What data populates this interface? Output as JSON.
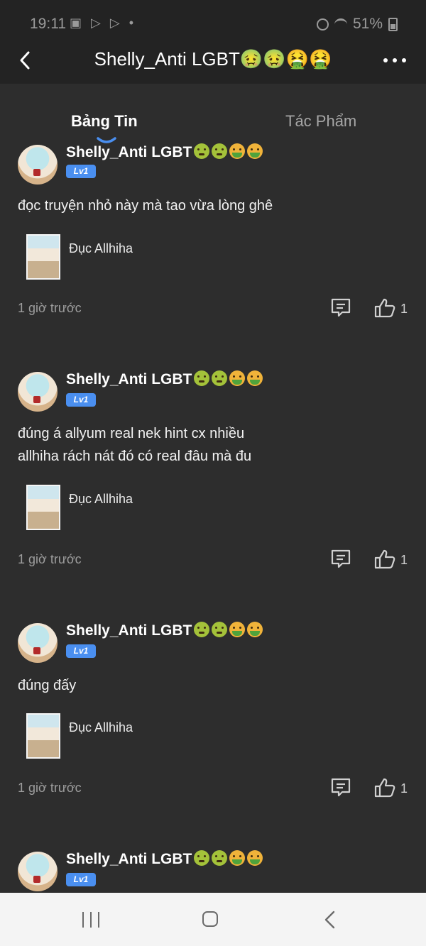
{
  "status_bar": {
    "time": "19:11",
    "left_icons": "▣ ▷ ▷ •",
    "battery_percent": "51%"
  },
  "header": {
    "title": "Shelly_Anti LGBT🤢🤢🤮🤮"
  },
  "tabs": [
    {
      "label": "Bảng Tin",
      "active": true
    },
    {
      "label": "Tác Phẩm",
      "active": false
    }
  ],
  "posts": [
    {
      "username": "Shelly_Anti LGBT",
      "level": "Lv1",
      "text": "đọc truyện nhỏ này mà tao vừa lòng ghê",
      "book_title": "Đục Allhiha",
      "time": "1 giờ trước",
      "likes": "1"
    },
    {
      "username": "Shelly_Anti LGBT",
      "level": "Lv1",
      "text": "đúng á allyum real nek hint cx nhiều\nallhiha rách nát đó có real đâu mà đu",
      "book_title": "Đục Allhiha",
      "time": "1 giờ trước",
      "likes": "1"
    },
    {
      "username": "Shelly_Anti LGBT",
      "level": "Lv1",
      "text": "đúng đấy",
      "book_title": "Đục Allhiha",
      "time": "1 giờ trước",
      "likes": "1"
    },
    {
      "username": "Shelly_Anti LGBT",
      "level": "Lv1"
    }
  ],
  "colors": {
    "background": "#2d2d2d",
    "header": "#232323",
    "level_badge": "#4a8ff0",
    "tab_indicator": "#4a8ff0",
    "nav_bar": "#f4f4f4"
  }
}
